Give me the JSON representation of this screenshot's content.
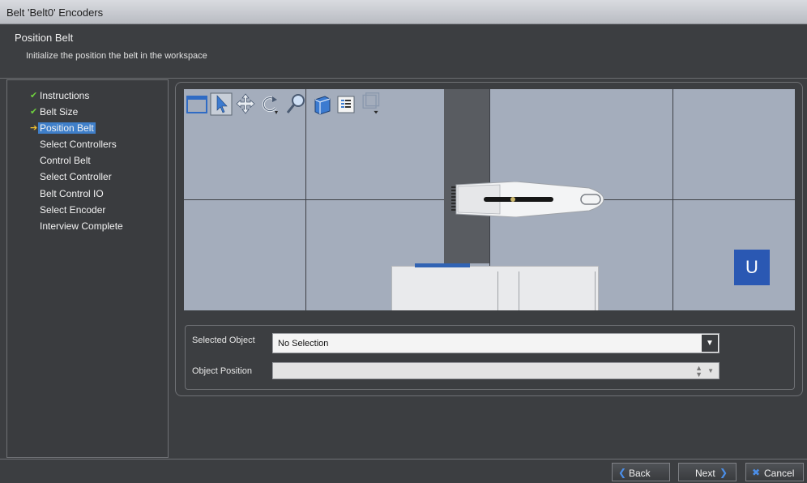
{
  "window": {
    "title": "Belt 'Belt0' Encoders"
  },
  "header": {
    "title": "Position Belt",
    "subtitle": "Initialize the position the belt in the workspace"
  },
  "nav": {
    "items": [
      {
        "label": "Instructions",
        "state": "done"
      },
      {
        "label": "Belt Size",
        "state": "done"
      },
      {
        "label": "Position Belt",
        "state": "current"
      },
      {
        "label": "Select Controllers",
        "state": "pending"
      },
      {
        "label": "Control Belt",
        "state": "pending"
      },
      {
        "label": "Select Controller",
        "state": "pending"
      },
      {
        "label": "Belt Control IO",
        "state": "pending"
      },
      {
        "label": "Select Encoder",
        "state": "pending"
      },
      {
        "label": "Interview Complete",
        "state": "pending"
      }
    ]
  },
  "viewport": {
    "toolbar_icons": [
      "window-icon",
      "pointer-icon",
      "pan-icon",
      "rotate-icon",
      "zoom-icon",
      "cube-icon",
      "properties-icon",
      "view-mode-icon"
    ],
    "orientation_button": "U",
    "colors": {
      "background": "#a4adbc",
      "belt": "#595c61",
      "orientation": "#2a58b3"
    }
  },
  "properties": {
    "selected_object_label": "Selected Object",
    "selected_object_value": "No Selection",
    "object_position_label": "Object Position",
    "object_position_value": ""
  },
  "footer": {
    "back_label": "Back",
    "next_label": "Next",
    "cancel_label": "Cancel"
  }
}
